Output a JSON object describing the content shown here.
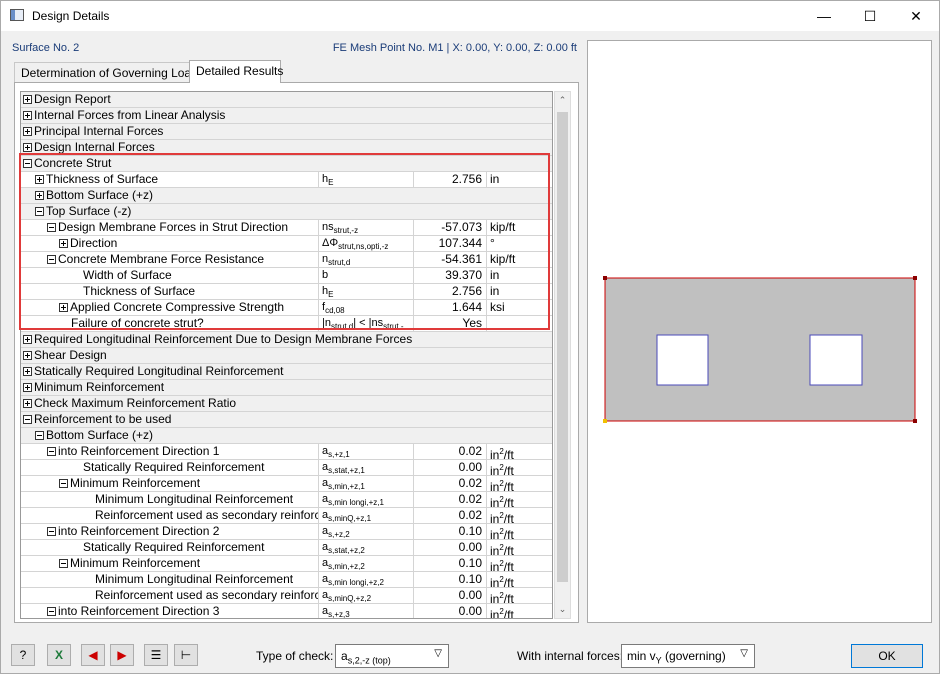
{
  "window": {
    "title": "Design Details",
    "minimize": "—",
    "maximize": "☐",
    "close": "✕"
  },
  "header": {
    "left": "Surface No. 2",
    "right": "FE Mesh Point No. M1  |  X: 0.00, Y: 0.00, Z: 0.00 ft"
  },
  "tabs": [
    {
      "label": "Determination of Governing Loads",
      "active": false
    },
    {
      "label": "Detailed Results",
      "active": true
    }
  ],
  "rows": [
    {
      "name": "Design Report",
      "indent": 0,
      "exp": "plus",
      "group": true
    },
    {
      "name": "Internal Forces from Linear Analysis",
      "indent": 0,
      "exp": "plus",
      "group": true
    },
    {
      "name": "Principal Internal Forces",
      "indent": 0,
      "exp": "plus",
      "group": true
    },
    {
      "name": "Design Internal Forces",
      "indent": 0,
      "exp": "plus",
      "group": true
    },
    {
      "name": "Concrete Strut",
      "indent": 0,
      "exp": "minus",
      "group": true
    },
    {
      "name": "Thickness of Surface",
      "indent": 1,
      "exp": "plus",
      "sym": "h",
      "sub": "E",
      "val": "2.756",
      "unit": "in"
    },
    {
      "name": "Bottom Surface (+z)",
      "indent": 1,
      "exp": "plus",
      "group": true
    },
    {
      "name": "Top Surface (-z)",
      "indent": 1,
      "exp": "minus",
      "group": true
    },
    {
      "name": "Design Membrane Forces in Strut Direction",
      "indent": 2,
      "exp": "minus",
      "sym": "ns",
      "sub": "strut,-z",
      "val": "-57.073",
      "unit": "kip/ft"
    },
    {
      "name": "Direction",
      "indent": 3,
      "exp": "plus",
      "sym": "ΔΦ",
      "sub": "strut,ns,opti,-z",
      "val": "107.344",
      "unit": "°"
    },
    {
      "name": "Concrete Membrane Force Resistance",
      "indent": 2,
      "exp": "minus",
      "sym": "n",
      "sub": "strut,d",
      "val": "-54.361",
      "unit": "kip/ft"
    },
    {
      "name": "Width of Surface",
      "indent": 4,
      "sym": "b",
      "val": "39.370",
      "unit": "in"
    },
    {
      "name": "Thickness of Surface",
      "indent": 4,
      "sym": "h",
      "sub": "E",
      "val": "2.756",
      "unit": "in"
    },
    {
      "name": "Applied Concrete Compressive Strength",
      "indent": 3,
      "exp": "plus",
      "sym": "f",
      "sub": "cd,08",
      "val": "1.644",
      "unit": "ksi"
    },
    {
      "name": "Failure of concrete strut?",
      "indent": 3,
      "sym": "|n",
      "sub": "strut,d",
      "sym2": "| < |ns",
      "sub2": "strut,-",
      "val": "Yes",
      "unit": ""
    },
    {
      "name": "Required Longitudinal Reinforcement Due to Design Membrane Forces",
      "indent": 0,
      "exp": "plus",
      "group": true
    },
    {
      "name": "Shear Design",
      "indent": 0,
      "exp": "plus",
      "group": true
    },
    {
      "name": "Statically Required Longitudinal Reinforcement",
      "indent": 0,
      "exp": "plus",
      "group": true
    },
    {
      "name": "Minimum Reinforcement",
      "indent": 0,
      "exp": "plus",
      "group": true
    },
    {
      "name": "Check Maximum Reinforcement Ratio",
      "indent": 0,
      "exp": "plus",
      "group": true
    },
    {
      "name": "Reinforcement to be used",
      "indent": 0,
      "exp": "minus",
      "group": true
    },
    {
      "name": "Bottom Surface (+z)",
      "indent": 1,
      "exp": "minus",
      "group": true
    },
    {
      "name": "into Reinforcement Direction 1",
      "indent": 2,
      "exp": "minus",
      "sym": "a",
      "sub": "s,+z,1",
      "val": "0.02",
      "unit": "in",
      "usup": "2",
      "usuf": "/ft"
    },
    {
      "name": "Statically Required Reinforcement",
      "indent": 4,
      "sym": "a",
      "sub": "s,stat,+z,1",
      "val": "0.00",
      "unit": "in",
      "usup": "2",
      "usuf": "/ft"
    },
    {
      "name": "Minimum Reinforcement",
      "indent": 3,
      "exp": "minus",
      "sym": "a",
      "sub": "s,min,+z,1",
      "val": "0.02",
      "unit": "in",
      "usup": "2",
      "usuf": "/ft"
    },
    {
      "name": "Minimum Longitudinal Reinforcement",
      "indent": 5,
      "sym": "a",
      "sub": "s,min longi,+z,1",
      "val": "0.02",
      "unit": "in",
      "usup": "2",
      "usuf": "/ft"
    },
    {
      "name": "Reinforcement used as secondary reinforcement",
      "indent": 5,
      "sym": "a",
      "sub": "s,minQ,+z,1",
      "val": "0.02",
      "unit": "in",
      "usup": "2",
      "usuf": "/ft"
    },
    {
      "name": "into Reinforcement Direction 2",
      "indent": 2,
      "exp": "minus",
      "sym": "a",
      "sub": "s,+z,2",
      "val": "0.10",
      "unit": "in",
      "usup": "2",
      "usuf": "/ft"
    },
    {
      "name": "Statically Required Reinforcement",
      "indent": 4,
      "sym": "a",
      "sub": "s,stat,+z,2",
      "val": "0.00",
      "unit": "in",
      "usup": "2",
      "usuf": "/ft"
    },
    {
      "name": "Minimum Reinforcement",
      "indent": 3,
      "exp": "minus",
      "sym": "a",
      "sub": "s,min,+z,2",
      "val": "0.10",
      "unit": "in",
      "usup": "2",
      "usuf": "/ft"
    },
    {
      "name": "Minimum Longitudinal Reinforcement",
      "indent": 5,
      "sym": "a",
      "sub": "s,min longi,+z,2",
      "val": "0.10",
      "unit": "in",
      "usup": "2",
      "usuf": "/ft"
    },
    {
      "name": "Reinforcement used as secondary reinforcement",
      "indent": 5,
      "sym": "a",
      "sub": "s,minQ,+z,2",
      "val": "0.00",
      "unit": "in",
      "usup": "2",
      "usuf": "/ft"
    },
    {
      "name": "into Reinforcement Direction 3",
      "indent": 2,
      "exp": "minus",
      "sym": "a",
      "sub": "s,+z,3",
      "val": "0.00",
      "unit": "in",
      "usup": "2",
      "usuf": "/ft"
    }
  ],
  "scrollbar": {
    "up": "⌃",
    "down": "⌄"
  },
  "preview": {
    "colors": {
      "surface": "#c0c0c0",
      "outline": "#cc0000",
      "opening_stroke": "#4a4ab8",
      "node": "#8b0000"
    }
  },
  "toolbar": {
    "help_icon": "help-icon",
    "excel_icon": "excel-icon",
    "prev_icon": "arrow-left-icon",
    "next_icon": "arrow-right-icon",
    "list_icon": "list-icon",
    "tree_icon": "tree-icon"
  },
  "bottom": {
    "type_of_check_label": "Type of check:",
    "type_of_check_value": "a",
    "type_of_check_sub": "s,2,-z (top)",
    "with_forces_label": "With internal forces:",
    "with_forces_value": "min v",
    "with_forces_sub": "Y",
    "with_forces_suffix": " (governing)",
    "ok_label": "OK"
  }
}
